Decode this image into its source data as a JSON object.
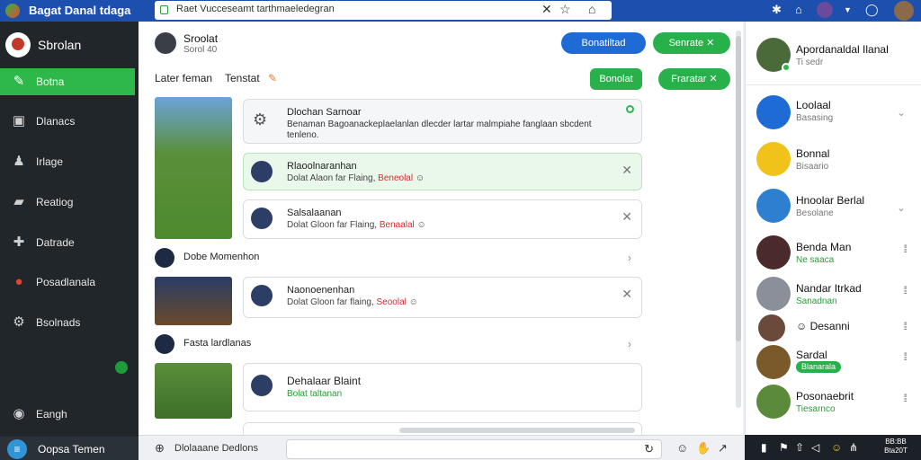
{
  "topbar": {
    "title": "Bagat Danal tdaga",
    "url": "Raet Vucceseamt tarthmaeledegran",
    "colors": {
      "bar": "#1d4fae"
    }
  },
  "sidebar": {
    "user_name": "Sbrolan",
    "items": [
      {
        "label": "Botna",
        "icon": "chat-icon",
        "active": true
      },
      {
        "label": "Dlanacs",
        "icon": "inbox-icon",
        "active": false
      },
      {
        "label": "Irlage",
        "icon": "people-icon",
        "active": false
      },
      {
        "label": "Reatiog",
        "icon": "message-icon",
        "active": false
      },
      {
        "label": "Datrade",
        "icon": "puzzle-icon",
        "active": false
      },
      {
        "label": "Posadlanala",
        "icon": "alert-icon",
        "active": false
      },
      {
        "label": "Bsolnads",
        "icon": "settings-icon",
        "active": false
      },
      {
        "label": "Eangh",
        "icon": "globe-icon",
        "active": false
      }
    ],
    "footer_label": "Oopsa Temen"
  },
  "main": {
    "header": {
      "name": "Sroolat",
      "subtitle": "Sorol 40"
    },
    "buttons": {
      "blue": "Bonatiltad",
      "green": "Senrate",
      "green2": "Bonolat",
      "green3": "Fraratar"
    },
    "tabs": [
      {
        "label": "Later feman"
      },
      {
        "label": "Tenstat"
      }
    ],
    "notice": {
      "title": "Dlochan Sarnoar",
      "body": "Benaman Bagoanackeplaelanlan dlecder lartar malmpiahe fanglaan sbcdent tenleno."
    },
    "cards": [
      {
        "name": "Rlaoolnaranhan",
        "meta": "Dolat Alaon far Flaing,",
        "tag": "Beneolal"
      },
      {
        "name": "Salsalaanan",
        "meta": "Dolat Gloon far Flaing,",
        "tag": "Benaalal"
      },
      {
        "name": "Naonoenenhan",
        "meta": "Dolat Gloon far flaing,",
        "tag": "Seoolal"
      },
      {
        "name": "Dehalaar Blaint",
        "meta": "Bolat taltanan",
        "tag": ""
      }
    ],
    "rows": [
      {
        "title": "Dobe Momenhon"
      },
      {
        "title": "Fasta lardlanas"
      }
    ]
  },
  "bottombar": {
    "label": "Dlolaaane Dedlons"
  },
  "rightpanel": {
    "contacts": [
      {
        "name": "Apordanaldal Ilanal",
        "status": "Ti sedr"
      },
      {
        "name": "Loolaal",
        "status": "Basasing"
      },
      {
        "name": "Bonnal",
        "status": "Bisaario"
      },
      {
        "name": "Hnoolar Berlal",
        "status": "Besolane"
      },
      {
        "name": "Benda Man",
        "status": "Ne saaca"
      },
      {
        "name": "Nandar Itrkad",
        "status": "Sanadnan"
      },
      {
        "name": "Desanni",
        "status": ""
      },
      {
        "name": "Sardal",
        "status": "Blanarala"
      },
      {
        "name": "Posonaebrit",
        "status": "Tiesarnco"
      }
    ]
  },
  "taskbar": {
    "clock_line1": "BB:BB",
    "clock_line2": "Bta20T"
  }
}
